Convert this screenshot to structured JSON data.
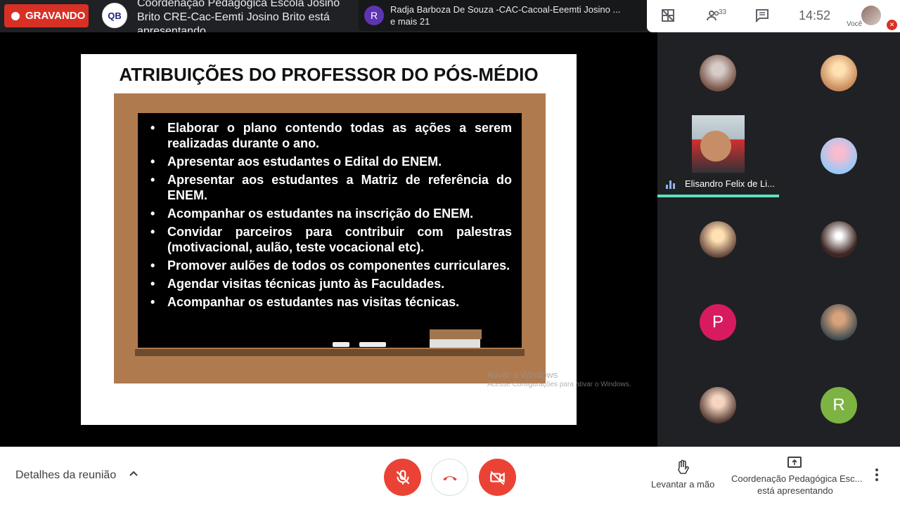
{
  "recording": {
    "label": "GRAVANDO"
  },
  "presenter": {
    "logo_text": "QB",
    "text": "Coordenação Pedagógica Escola Josino Brito CRE-Cac-Eemti Josino Brito está apresentando"
  },
  "notification": {
    "avatar_letter": "R",
    "line1": "Radja Barboza De Souza -CAC-Cacoal-Eeemti Josino ...",
    "line2": "e mais 21"
  },
  "topright": {
    "people_count": "33",
    "clock": "14:52",
    "you_label": "Você"
  },
  "slide": {
    "title": "ATRIBUIÇÕES DO PROFESSOR DO PÓS-MÉDIO",
    "bullets": [
      "Elaborar o plano contendo todas as ações a serem realizadas durante o ano.",
      "Apresentar aos estudantes o Edital do ENEM.",
      "Apresentar aos estudantes a Matriz de referência do ENEM.",
      "Acompanhar os estudantes na inscrição do ENEM.",
      "Convidar parceiros para contribuir com palestras (motivacional, aulão, teste vocacional etc).",
      "Promover aulões de todos os componentes curriculares.",
      "Agendar visitas técnicas junto às Faculdades.",
      "Acompanhar os estudantes nas visitas técnicas."
    ],
    "watermark_line1": "Ativar o Windows",
    "watermark_line2": "Acesse Configurações para ativar o Windows."
  },
  "participants": {
    "active_name": "Elisandro Felix de Li...",
    "letter_p": "P",
    "letter_r": "R",
    "color_p": "#d81b60",
    "color_r": "#7cb342"
  },
  "bottom": {
    "meeting_details": "Detalhes da reunião",
    "raise_hand": "Levantar a mão",
    "presenting_line1": "Coordenação Pedagógica Esc...",
    "presenting_line2": "está apresentando"
  }
}
